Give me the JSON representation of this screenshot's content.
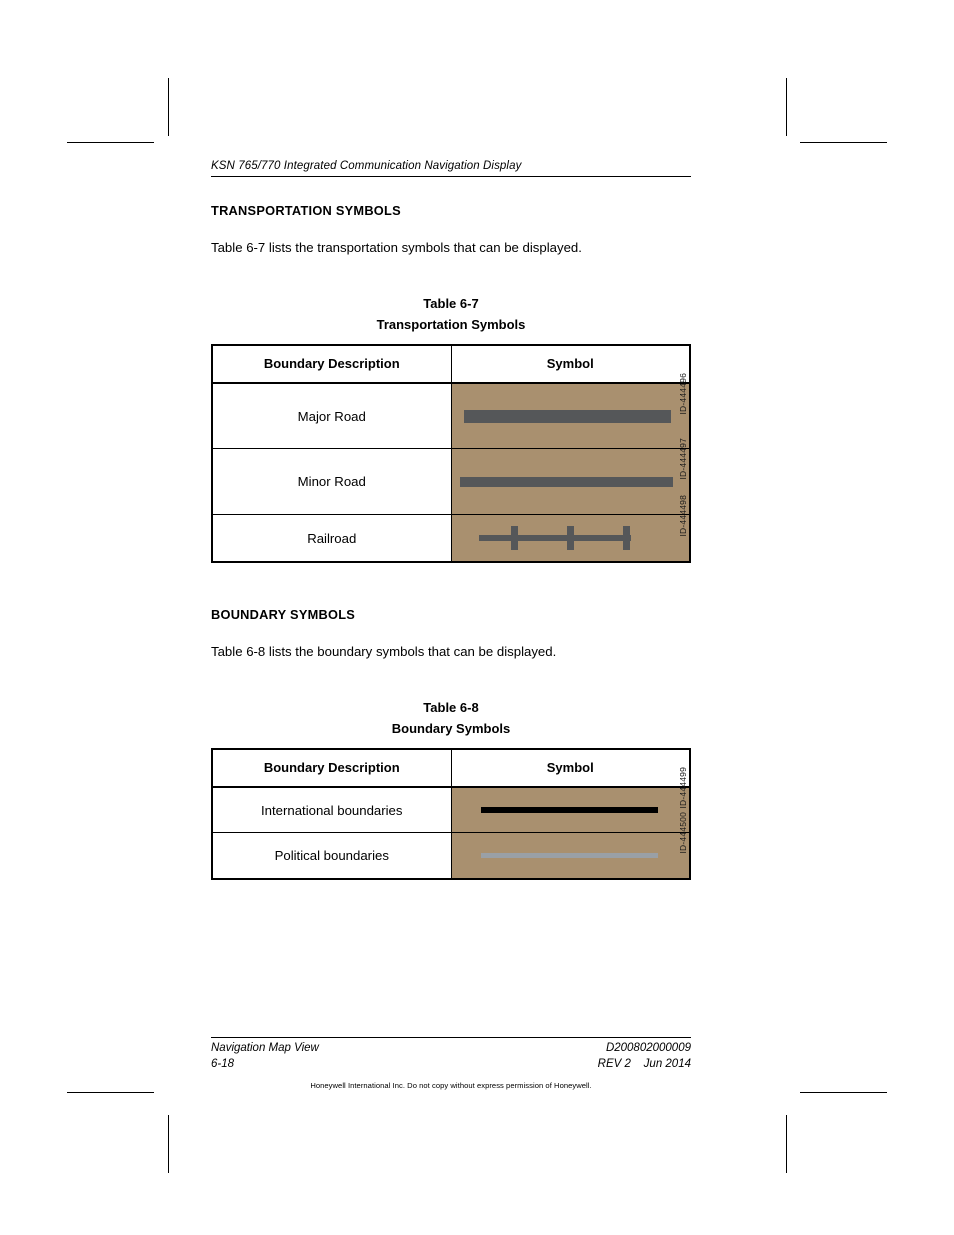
{
  "page": {
    "running_header": "KSN 765/770 Integrated Communication Navigation Display"
  },
  "sections": [
    {
      "heading": "TRANSPORTATION SYMBOLS",
      "intro": "Table 6‑7 lists the transportation symbols that can be displayed.",
      "caption_line1": "Table 6‑7",
      "caption_line2": "Transportation Symbols"
    },
    {
      "heading": "BOUNDARY SYMBOLS",
      "intro": "Table 6‑8 lists the boundary symbols that can be displayed.",
      "caption_line1": "Table 6‑8",
      "caption_line2": "Boundary Symbols"
    }
  ],
  "table_transportation": {
    "columns": [
      "Boundary Description",
      "Symbol"
    ],
    "rows": [
      {
        "description": "Major Road",
        "symbol_kind": "thick-road-line",
        "symbol_id": "ID‑444496"
      },
      {
        "description": "Minor Road",
        "symbol_kind": "medium-road-line",
        "symbol_id": "ID‑444497"
      },
      {
        "description": "Railroad",
        "symbol_kind": "railroad-line",
        "symbol_id": "ID‑444498"
      }
    ]
  },
  "table_boundary": {
    "columns": [
      "Boundary Description",
      "Symbol"
    ],
    "rows": [
      {
        "description": "International boundaries",
        "symbol_kind": "solid-black-line",
        "symbol_id": "ID‑444499"
      },
      {
        "description": "Political boundaries",
        "symbol_kind": "solid-gray-line",
        "symbol_id": "ID‑444500"
      }
    ]
  },
  "footer": {
    "doc_section": "Navigation Map View",
    "page_number": "6-18",
    "doc_number": "D200802000009",
    "revision": "REV 2",
    "date": "Jun 2014",
    "copyright": "Honeywell International Inc. Do not copy without express permission of Honeywell."
  },
  "colors": {
    "map_background": "#a9906f",
    "road_gray": "#555759",
    "boundary_black": "#000000",
    "boundary_gray": "#9aa0a6"
  }
}
